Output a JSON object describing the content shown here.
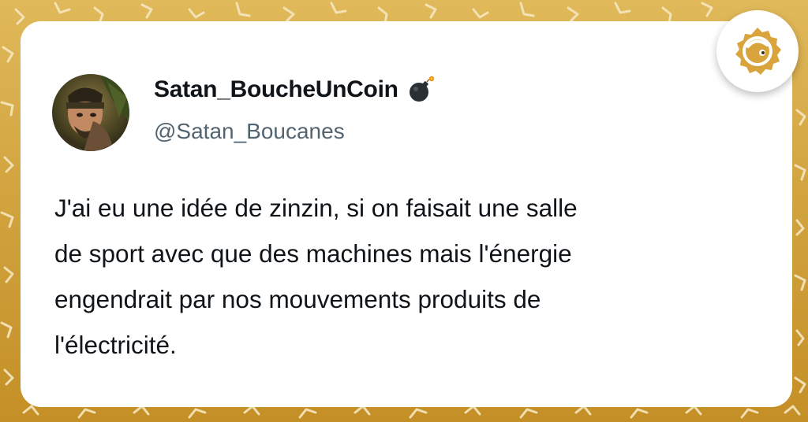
{
  "tweet": {
    "display_name": "Satan_BoucheUnCoin",
    "handle": "@Satan_Boucanes",
    "name_emoji_icon": "bomb-icon",
    "text": "J'ai eu une idée de zinzin, si on faisait une salle\nde sport avec que des machines mais l'énergie\nengendrait par nos mouvements produits de\nl'électricité."
  },
  "brand": {
    "logo_icon": "brand-logo-icon",
    "accent_color": "#d9a43c",
    "background_color": "#d2a440"
  }
}
